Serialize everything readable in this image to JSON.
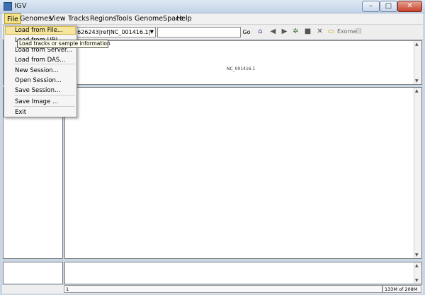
{
  "window": {
    "title": "IGV",
    "min": "–",
    "max": "□",
    "close": "✕"
  },
  "menubar": [
    "File",
    "Genomes",
    "View",
    "Tracks",
    "Regions",
    "Tools",
    "GenomeSpace",
    "Help"
  ],
  "toolbar": {
    "genome_value": "gi|9626243|ref|NC_001416.1|",
    "locus_value": "",
    "go_label": "Go",
    "exome_label": "Exome"
  },
  "file_menu": {
    "items": [
      "Load from File...",
      "Load from URL...",
      "Load from Server...",
      "Load from DAS...",
      "New Session...",
      "Open Session...",
      "Save Session...",
      "Save Image ...",
      "Exit"
    ]
  },
  "tooltip": "Load tracks or sample information",
  "header": {
    "chromosome": "NC_001416.1"
  },
  "status": {
    "position": "1",
    "memory": "133M of 208M"
  },
  "icons": [
    "home-icon",
    "back-icon",
    "forward-icon",
    "refresh-icon",
    "roi-icon",
    "close-tracks-icon",
    "popup-info-icon",
    "exome-toggle-icon"
  ]
}
